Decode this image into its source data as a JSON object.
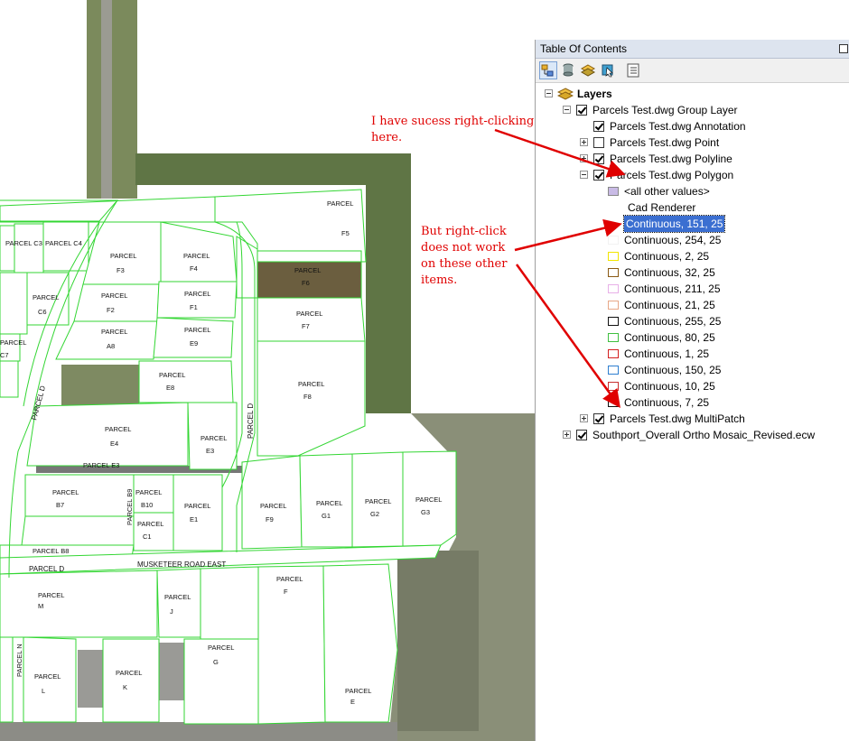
{
  "annotations": {
    "top": "I have sucess right-clicking\nhere.",
    "middle": "But right-click\ndoes not work\non these other\nitems."
  },
  "map": {
    "road_label": "MUSKETEER ROAD EAST",
    "street_labels": [
      "PARCEL D",
      "PARCEL D",
      "PARCEL D"
    ],
    "parcel_word": "PARCEL",
    "parcels": [
      "C3",
      "C4",
      "F3",
      "F4",
      "F5",
      "F6",
      "C6",
      "F2",
      "F1",
      "F7",
      "C7",
      "A8",
      "E9",
      "E8",
      "F8",
      "E4",
      "E3",
      "B7",
      "B10",
      "B9",
      "E1",
      "F9",
      "G1",
      "G2",
      "G3",
      "C1",
      "B8",
      "M",
      "J",
      "F",
      "N",
      "G",
      "L",
      "K",
      "E"
    ],
    "curve_label": "PARCEL E3"
  },
  "toc": {
    "title": "Table Of Contents",
    "toolbar": [
      "list-by-drawing-order",
      "list-by-source",
      "list-by-visibility",
      "list-by-selection",
      "options"
    ],
    "layers_root": "Layers",
    "group_layer": "Parcels Test.dwg Group Layer",
    "items": [
      {
        "label": "Parcels Test.dwg Annotation",
        "checked": true,
        "expander": "none"
      },
      {
        "label": "Parcels Test.dwg Point",
        "checked": false,
        "expander": "plus"
      },
      {
        "label": "Parcels Test.dwg Polyline",
        "checked": true,
        "expander": "plus"
      },
      {
        "label": "Parcels Test.dwg Polygon",
        "checked": true,
        "expander": "minus"
      }
    ],
    "polygon_legend": {
      "other_values": "<all other values>",
      "other_color": "#c9bbe6",
      "renderer_heading": "Cad Renderer",
      "classes": [
        {
          "label": "Continuous, 151, 25",
          "color": "#ffffff",
          "selected": true
        },
        {
          "label": "Continuous, 254, 25",
          "color": "#f2f2f2",
          "selected": false
        },
        {
          "label": "Continuous, 2, 25",
          "color": "#f2e600",
          "selected": false
        },
        {
          "label": "Continuous, 32, 25",
          "color": "#8a5a14",
          "selected": false
        },
        {
          "label": "Continuous, 211, 25",
          "color": "#e8b0e8",
          "selected": false
        },
        {
          "label": "Continuous, 21, 25",
          "color": "#e8a888",
          "selected": false
        },
        {
          "label": "Continuous, 255, 25",
          "color": "#111111",
          "selected": false
        },
        {
          "label": "Continuous, 80, 25",
          "color": "#40c040",
          "selected": false
        },
        {
          "label": "Continuous, 1, 25",
          "color": "#d42020",
          "selected": false
        },
        {
          "label": "Continuous, 150, 25",
          "color": "#2f7fd0",
          "selected": false
        },
        {
          "label": "Continuous, 10, 25",
          "color": "#c83030",
          "selected": false
        },
        {
          "label": "Continuous, 7, 25",
          "color": "#111111",
          "selected": false
        }
      ]
    },
    "multipatch": {
      "label": "Parcels Test.dwg MultiPatch",
      "checked": true
    },
    "raster": {
      "label": "Southport_Overall Ortho Mosaic_Revised.ecw",
      "checked": true
    }
  }
}
